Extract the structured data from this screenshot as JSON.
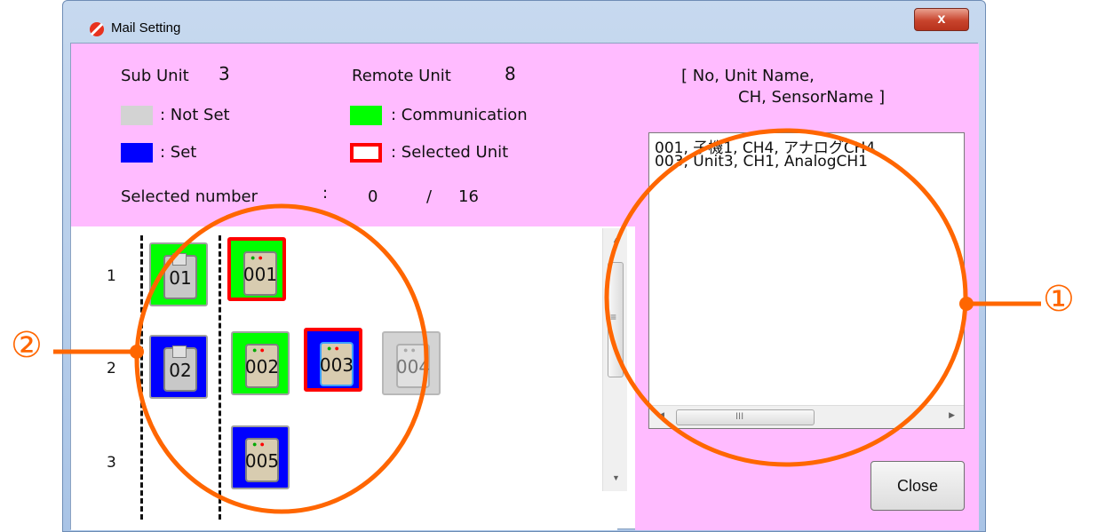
{
  "window": {
    "title": "Mail Setting",
    "close_glyph": "x"
  },
  "header": {
    "sub_unit_label": "Sub Unit",
    "sub_unit_value": "3",
    "remote_unit_label": "Remote Unit",
    "remote_unit_value": "8",
    "legend": {
      "not_set": ": Not Set",
      "set": ": Set",
      "communication": ": Communication",
      "selected_unit": ": Selected Unit"
    },
    "selected_number_label": "Selected number",
    "selected_colon": ":",
    "selected_count": "0",
    "selected_slash": "/",
    "selected_total": "16"
  },
  "list_header": {
    "line1": "[ No, Unit Name,",
    "line2": "CH, SensorName ]"
  },
  "list_items": [
    "001, 子機1, CH4, アナログCH4",
    "003, Unit3, CH1, AnalogCH1"
  ],
  "rows": [
    {
      "label": "1"
    },
    {
      "label": "2"
    },
    {
      "label": "3"
    }
  ],
  "sub_units": [
    {
      "label": "01",
      "state": "communication"
    },
    {
      "label": "02",
      "state": "set"
    }
  ],
  "remote_units": [
    {
      "label": "001",
      "state": "communication",
      "selected": true
    },
    {
      "label": "002",
      "state": "communication",
      "selected": false
    },
    {
      "label": "003",
      "state": "set",
      "selected": true
    },
    {
      "label": "004",
      "state": "not_set",
      "selected": false
    },
    {
      "label": "005",
      "state": "set",
      "selected": false
    }
  ],
  "scroll_glyphs": {
    "hthumb": "III",
    "vthumb": "≡"
  },
  "close_button": {
    "label": "Close"
  },
  "annotations": {
    "callout_1": "①",
    "callout_2": "②"
  },
  "colors": {
    "pink": "#ffbbff",
    "not_set": "#d3d3d3",
    "set": "#0000ff",
    "communication": "#00ff00",
    "selected": "#ff0000",
    "annotation": "#ff6600"
  }
}
